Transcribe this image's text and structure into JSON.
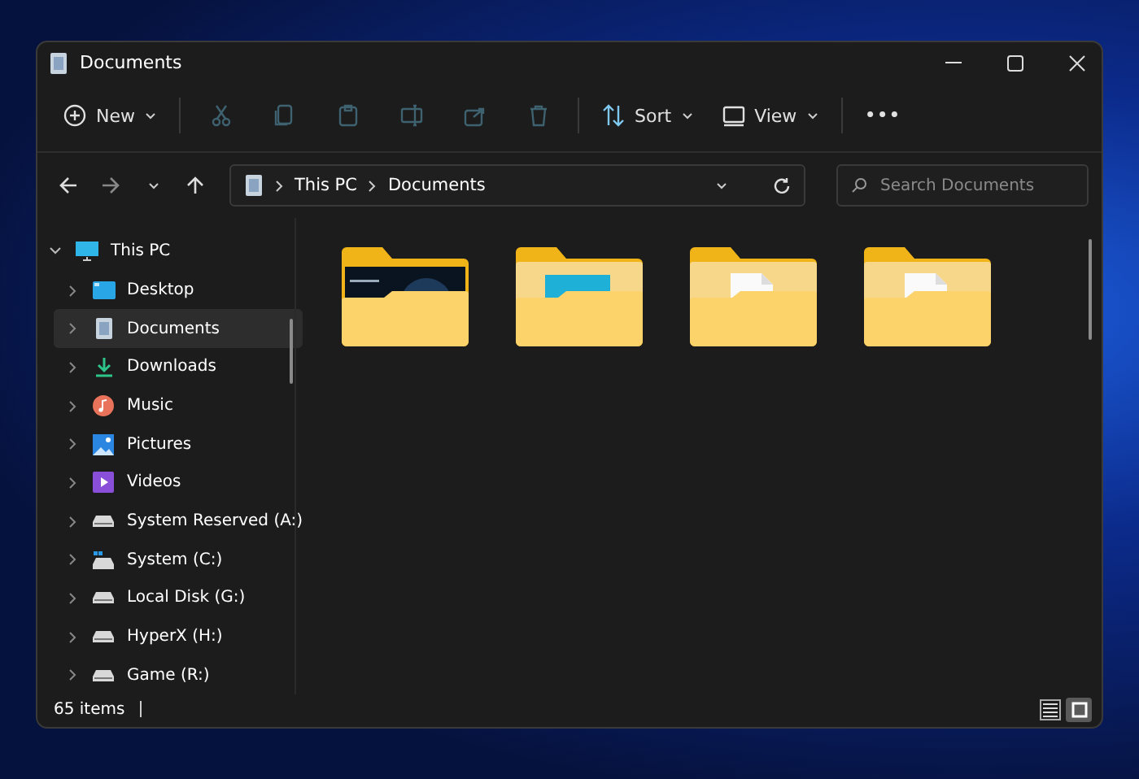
{
  "window": {
    "title": "Documents"
  },
  "toolbar": [
    {
      "kind": "new",
      "label": "New",
      "disabled": false
    },
    {
      "kind": "cut",
      "disabled": true
    },
    {
      "kind": "copy",
      "disabled": true
    },
    {
      "kind": "paste",
      "disabled": true
    },
    {
      "kind": "rename",
      "disabled": true
    },
    {
      "kind": "share",
      "disabled": true
    },
    {
      "kind": "delete",
      "disabled": true
    },
    {
      "kind": "sort",
      "label": "Sort",
      "disabled": false
    },
    {
      "kind": "view",
      "label": "View",
      "disabled": false
    },
    {
      "kind": "more",
      "label": "•••",
      "disabled": false
    }
  ],
  "address": {
    "path": [
      "This PC",
      "Documents"
    ],
    "search": {
      "placeholder": "Search Documents"
    }
  },
  "sidebar": {
    "items": [
      {
        "label": "This PC",
        "kind": "pc",
        "expanded": true,
        "selected": false,
        "children": [
          {
            "label": "Desktop",
            "kind": "desktop",
            "expanded": false,
            "selected": false
          },
          {
            "label": "Documents",
            "kind": "documents",
            "expanded": false,
            "selected": true
          },
          {
            "label": "Downloads",
            "kind": "downloads",
            "expanded": false,
            "selected": false
          },
          {
            "label": "Music",
            "kind": "music",
            "expanded": false,
            "selected": false
          },
          {
            "label": "Pictures",
            "kind": "pictures",
            "expanded": false,
            "selected": false
          },
          {
            "label": "Videos",
            "kind": "videos",
            "expanded": false,
            "selected": false
          },
          {
            "label": "System Reserved (A:)",
            "kind": "drive",
            "expanded": false,
            "selected": false
          },
          {
            "label": "System (C:)",
            "kind": "system-drive",
            "expanded": false,
            "selected": false
          },
          {
            "label": "Local Disk (G:)",
            "kind": "drive",
            "expanded": false,
            "selected": false
          },
          {
            "label": "HyperX (H:)",
            "kind": "drive",
            "expanded": false,
            "selected": false
          },
          {
            "label": "Game (R:)",
            "kind": "drive",
            "expanded": false,
            "selected": false
          }
        ]
      }
    ]
  },
  "folders": [
    {
      "kind": "dark-preview"
    },
    {
      "kind": "image-preview"
    },
    {
      "kind": "document"
    },
    {
      "kind": "document"
    }
  ],
  "status_bar": {
    "count": "65 items",
    "views": [
      {
        "kind": "details",
        "selected": false
      },
      {
        "kind": "large-icons",
        "selected": true
      }
    ]
  }
}
